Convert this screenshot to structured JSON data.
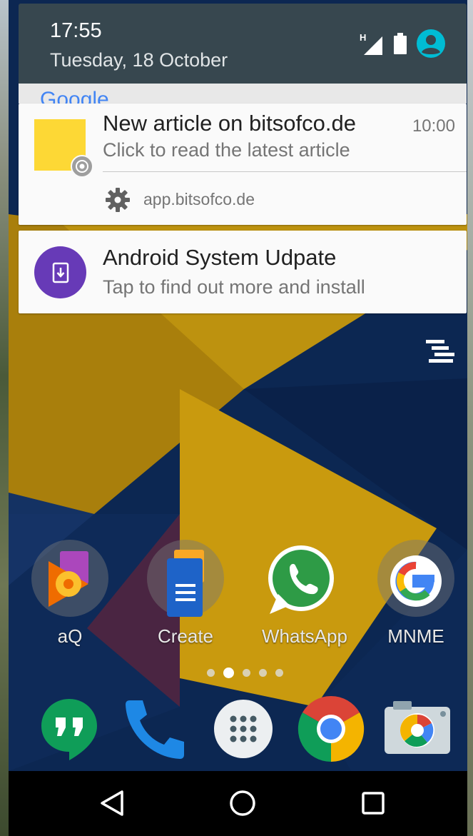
{
  "status_bar": {
    "time": "17:55",
    "date": "Tuesday, 18 October",
    "network_type": "H",
    "icons": [
      "signal-icon",
      "battery-icon",
      "account-icon"
    ]
  },
  "google_peek": "Google",
  "notifications": [
    {
      "title": "New article on bitsofco.de",
      "text": "Click to read the latest article",
      "time": "10:00",
      "source": "app.bitsofco.de",
      "icon": "yellow-square",
      "badge_icon": "chrome-icon",
      "settings_icon": "gear-icon"
    },
    {
      "title": "Android System Udpate",
      "text": "Tap to find out more and install",
      "icon": "system-update-icon"
    }
  ],
  "home_apps": [
    {
      "label": "aQ",
      "icon": "play-music-folder-icon"
    },
    {
      "label": "Create",
      "icon": "docs-folder-icon"
    },
    {
      "label": "WhatsApp",
      "icon": "whatsapp-icon"
    },
    {
      "label": "MNME",
      "icon": "google-folder-icon"
    }
  ],
  "page_indicator": {
    "pages": 5,
    "active_page": 2
  },
  "dock_apps": [
    "hangouts-icon",
    "phone-icon",
    "app-drawer-icon",
    "chrome-icon",
    "camera-icon"
  ],
  "nav_buttons": [
    "back-icon",
    "home-icon",
    "recents-icon"
  ],
  "colors": {
    "status_bar": "#37474f",
    "purple_accent": "#673ab7",
    "yellow_square": "#fdd835",
    "wallpaper_navy": "#0c2752",
    "wallpaper_yellow": "#c99a0e",
    "wallpaper_red": "#a11a1a"
  }
}
